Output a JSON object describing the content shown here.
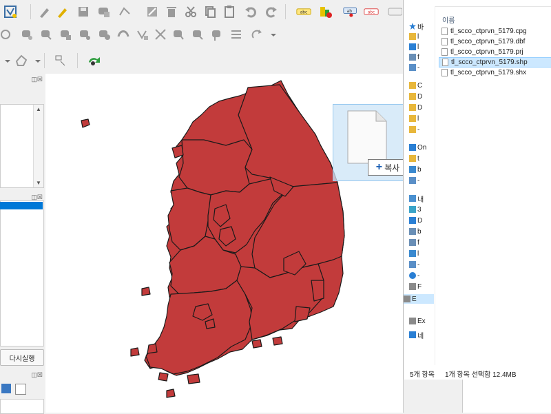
{
  "qgis": {
    "left_panel": {
      "rerun_button": "다시실행"
    },
    "map": {
      "feature_fill": "#c23b3b",
      "feature_stroke": "#1a1a1a"
    },
    "drag_overlay": {
      "copy_label": "복사",
      "plus": "+"
    }
  },
  "explorer": {
    "column_header": "이름",
    "nav_items": [
      {
        "icon": "star-icon",
        "label": "바"
      },
      {
        "icon": "folder-icon",
        "label": "l"
      },
      {
        "icon": "download-icon",
        "label": "l"
      },
      {
        "icon": "document-icon",
        "label": "f"
      },
      {
        "icon": "picture-icon",
        "label": "-"
      },
      {
        "icon": "folder-icon",
        "label": "C"
      },
      {
        "icon": "folder-icon",
        "label": "D"
      },
      {
        "icon": "folder-icon",
        "label": "D"
      },
      {
        "icon": "folder-icon",
        "label": "l"
      },
      {
        "icon": "folder-icon",
        "label": "-"
      },
      {
        "icon": "onedrive-icon",
        "label": "On"
      },
      {
        "icon": "folder-icon",
        "label": "t"
      },
      {
        "icon": "desktop-icon",
        "label": "b"
      },
      {
        "icon": "picture-icon",
        "label": "-"
      },
      {
        "icon": "pc-icon",
        "label": "내"
      },
      {
        "icon": "3d-icon",
        "label": "3"
      },
      {
        "icon": "download-icon",
        "label": "D"
      },
      {
        "icon": "document-icon",
        "label": "b"
      },
      {
        "icon": "document-icon",
        "label": "f"
      },
      {
        "icon": "desktop-icon",
        "label": "l"
      },
      {
        "icon": "picture-icon",
        "label": "-"
      },
      {
        "icon": "music-icon",
        "label": "-"
      },
      {
        "icon": "drive-icon",
        "label": "F"
      },
      {
        "icon": "drive-icon",
        "label": "E"
      },
      {
        "icon": "drive-icon",
        "label": "Ex"
      },
      {
        "icon": "network-icon",
        "label": "네"
      }
    ],
    "files": [
      {
        "name": "tl_scco_ctprvn_5179.cpg",
        "selected": false
      },
      {
        "name": "tl_scco_ctprvn_5179.dbf",
        "selected": false
      },
      {
        "name": "tl_scco_ctprvn_5179.prj",
        "selected": false
      },
      {
        "name": "tl_scco_ctprvn_5179.shp",
        "selected": true
      },
      {
        "name": "tl_scco_ctprvn_5179.shx",
        "selected": false
      }
    ],
    "status_count": "5개 항목",
    "status_selection": "1개 항목 선택함 12.4MB"
  }
}
